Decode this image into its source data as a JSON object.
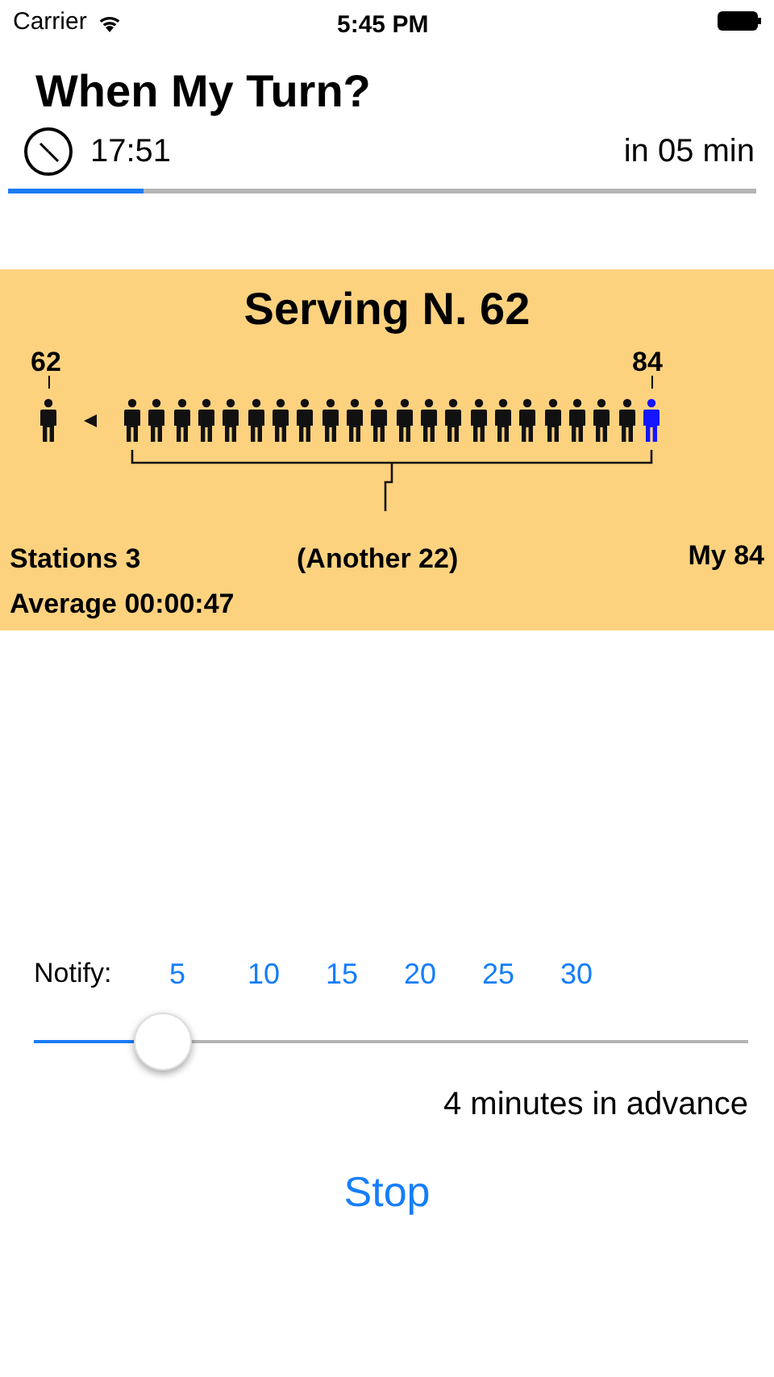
{
  "status_bar": {
    "carrier": "Carrier",
    "time": "5:45 PM"
  },
  "title": "When My Turn?",
  "eta": {
    "time": "17:51",
    "remaining": "in 05 min",
    "level": 0.18
  },
  "panel": {
    "serving": "Serving N. 62",
    "current_label": "62",
    "my_label": "84",
    "another": "(Another 22)",
    "stations": "Stations 3",
    "my": "My 84",
    "average": "Average 00:00:47",
    "queue": [
      {
        "mine": false
      },
      {
        "mine": false
      },
      {
        "mine": false
      },
      {
        "mine": false
      },
      {
        "mine": false
      },
      {
        "mine": false
      },
      {
        "mine": false
      },
      {
        "mine": false
      },
      {
        "mine": false
      },
      {
        "mine": false
      },
      {
        "mine": false
      },
      {
        "mine": false
      },
      {
        "mine": false
      },
      {
        "mine": false
      },
      {
        "mine": false
      },
      {
        "mine": false
      },
      {
        "mine": false
      },
      {
        "mine": false
      },
      {
        "mine": false
      },
      {
        "mine": false
      },
      {
        "mine": false
      },
      {
        "mine": true
      }
    ]
  },
  "notify": {
    "label": "Notify:",
    "ticks": [
      "5",
      "10",
      "15",
      "20",
      "25",
      "30"
    ],
    "level": 0.18,
    "advance": "4 minutes in advance"
  },
  "stop_button": "Stop"
}
